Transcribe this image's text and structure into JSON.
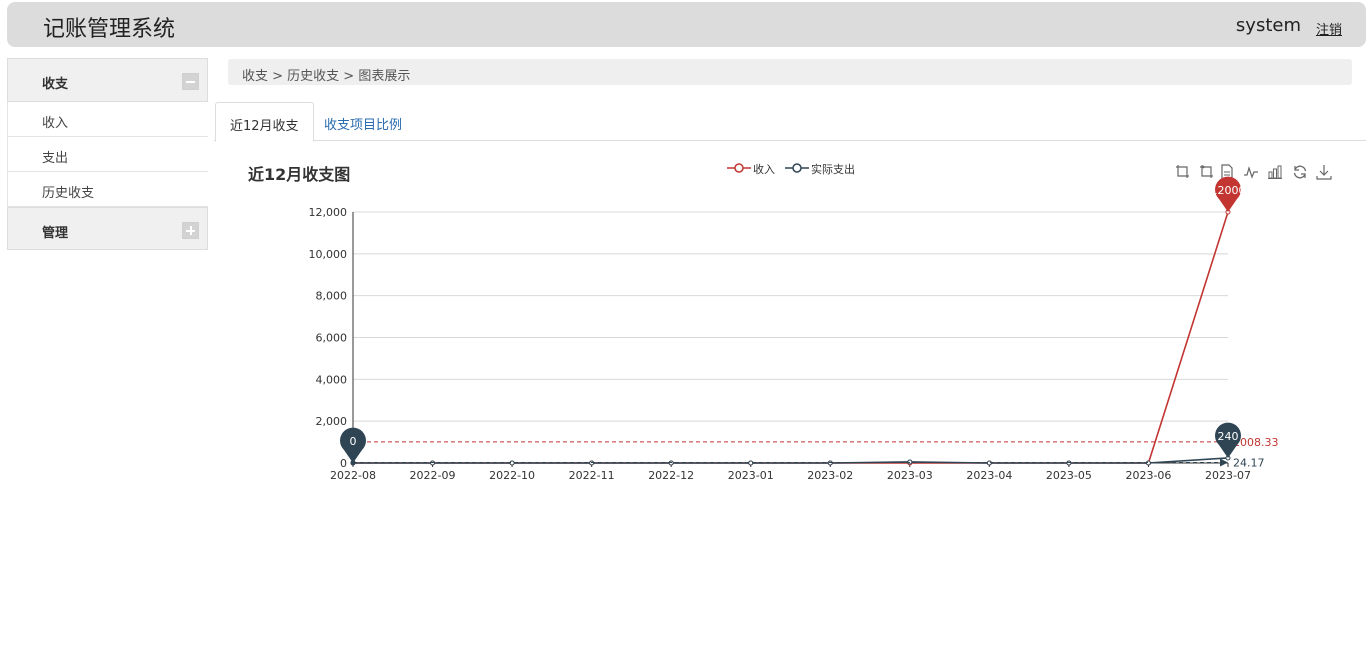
{
  "header": {
    "app_title": "记账管理系统",
    "user": "system",
    "logout": "注销"
  },
  "sidebar": {
    "groups": [
      {
        "label": "收支",
        "expanded": true,
        "items": [
          {
            "label": "收入"
          },
          {
            "label": "支出"
          },
          {
            "label": "历史收支"
          }
        ]
      },
      {
        "label": "管理",
        "expanded": false,
        "items": []
      }
    ]
  },
  "breadcrumb": "收支 > 历史收支 > 图表展示",
  "tabs": [
    {
      "label": "近12月收支",
      "active": true
    },
    {
      "label": "收支项目比例",
      "active": false
    }
  ],
  "toolbox": [
    "zoom-icon",
    "zoom-reset-icon",
    "data-view-icon",
    "line-chart-icon",
    "bar-chart-icon",
    "restore-icon",
    "download-icon"
  ],
  "chart_data": {
    "type": "line",
    "title": "近12月收支图",
    "x": [
      "2022-08",
      "2022-09",
      "2022-10",
      "2022-11",
      "2022-12",
      "2023-01",
      "2023-02",
      "2023-03",
      "2023-04",
      "2023-05",
      "2023-06",
      "2023-07"
    ],
    "ylim": [
      0,
      12000
    ],
    "yticks": [
      0,
      2000,
      4000,
      6000,
      8000,
      10000,
      12000
    ],
    "ytick_labels": [
      "0",
      "2,000",
      "4,000",
      "6,000",
      "8,000",
      "10,000",
      "12,000"
    ],
    "grid": true,
    "legend_position": "top-center",
    "series": [
      {
        "name": "收入",
        "color": "#c23531",
        "values": [
          0,
          0,
          0,
          0,
          0,
          0,
          0,
          0,
          0,
          0,
          0,
          12000
        ],
        "max_pin": {
          "label": "12000",
          "index": 11
        },
        "average_line": {
          "label": "1008.33",
          "value": 1008.33
        }
      },
      {
        "name": "实际支出",
        "color": "#2f4554",
        "values": [
          0,
          0,
          0,
          0,
          0,
          0,
          0,
          50,
          0,
          0,
          0,
          240
        ],
        "max_pin": {
          "label": "240",
          "index": 11
        },
        "min_pin": {
          "label": "0",
          "index": 0
        },
        "average_line": {
          "label": "24.17",
          "value": 24.17
        }
      }
    ]
  }
}
